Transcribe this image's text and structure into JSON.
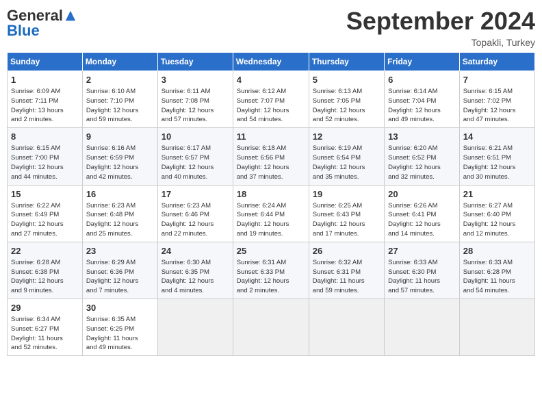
{
  "header": {
    "logo_general": "General",
    "logo_blue": "Blue",
    "month_title": "September 2024",
    "location": "Topakli, Turkey"
  },
  "days_of_week": [
    "Sunday",
    "Monday",
    "Tuesday",
    "Wednesday",
    "Thursday",
    "Friday",
    "Saturday"
  ],
  "weeks": [
    [
      {
        "day": "1",
        "info": "Sunrise: 6:09 AM\nSunset: 7:11 PM\nDaylight: 13 hours\nand 2 minutes."
      },
      {
        "day": "2",
        "info": "Sunrise: 6:10 AM\nSunset: 7:10 PM\nDaylight: 12 hours\nand 59 minutes."
      },
      {
        "day": "3",
        "info": "Sunrise: 6:11 AM\nSunset: 7:08 PM\nDaylight: 12 hours\nand 57 minutes."
      },
      {
        "day": "4",
        "info": "Sunrise: 6:12 AM\nSunset: 7:07 PM\nDaylight: 12 hours\nand 54 minutes."
      },
      {
        "day": "5",
        "info": "Sunrise: 6:13 AM\nSunset: 7:05 PM\nDaylight: 12 hours\nand 52 minutes."
      },
      {
        "day": "6",
        "info": "Sunrise: 6:14 AM\nSunset: 7:04 PM\nDaylight: 12 hours\nand 49 minutes."
      },
      {
        "day": "7",
        "info": "Sunrise: 6:15 AM\nSunset: 7:02 PM\nDaylight: 12 hours\nand 47 minutes."
      }
    ],
    [
      {
        "day": "8",
        "info": "Sunrise: 6:15 AM\nSunset: 7:00 PM\nDaylight: 12 hours\nand 44 minutes."
      },
      {
        "day": "9",
        "info": "Sunrise: 6:16 AM\nSunset: 6:59 PM\nDaylight: 12 hours\nand 42 minutes."
      },
      {
        "day": "10",
        "info": "Sunrise: 6:17 AM\nSunset: 6:57 PM\nDaylight: 12 hours\nand 40 minutes."
      },
      {
        "day": "11",
        "info": "Sunrise: 6:18 AM\nSunset: 6:56 PM\nDaylight: 12 hours\nand 37 minutes."
      },
      {
        "day": "12",
        "info": "Sunrise: 6:19 AM\nSunset: 6:54 PM\nDaylight: 12 hours\nand 35 minutes."
      },
      {
        "day": "13",
        "info": "Sunrise: 6:20 AM\nSunset: 6:52 PM\nDaylight: 12 hours\nand 32 minutes."
      },
      {
        "day": "14",
        "info": "Sunrise: 6:21 AM\nSunset: 6:51 PM\nDaylight: 12 hours\nand 30 minutes."
      }
    ],
    [
      {
        "day": "15",
        "info": "Sunrise: 6:22 AM\nSunset: 6:49 PM\nDaylight: 12 hours\nand 27 minutes."
      },
      {
        "day": "16",
        "info": "Sunrise: 6:23 AM\nSunset: 6:48 PM\nDaylight: 12 hours\nand 25 minutes."
      },
      {
        "day": "17",
        "info": "Sunrise: 6:23 AM\nSunset: 6:46 PM\nDaylight: 12 hours\nand 22 minutes."
      },
      {
        "day": "18",
        "info": "Sunrise: 6:24 AM\nSunset: 6:44 PM\nDaylight: 12 hours\nand 19 minutes."
      },
      {
        "day": "19",
        "info": "Sunrise: 6:25 AM\nSunset: 6:43 PM\nDaylight: 12 hours\nand 17 minutes."
      },
      {
        "day": "20",
        "info": "Sunrise: 6:26 AM\nSunset: 6:41 PM\nDaylight: 12 hours\nand 14 minutes."
      },
      {
        "day": "21",
        "info": "Sunrise: 6:27 AM\nSunset: 6:40 PM\nDaylight: 12 hours\nand 12 minutes."
      }
    ],
    [
      {
        "day": "22",
        "info": "Sunrise: 6:28 AM\nSunset: 6:38 PM\nDaylight: 12 hours\nand 9 minutes."
      },
      {
        "day": "23",
        "info": "Sunrise: 6:29 AM\nSunset: 6:36 PM\nDaylight: 12 hours\nand 7 minutes."
      },
      {
        "day": "24",
        "info": "Sunrise: 6:30 AM\nSunset: 6:35 PM\nDaylight: 12 hours\nand 4 minutes."
      },
      {
        "day": "25",
        "info": "Sunrise: 6:31 AM\nSunset: 6:33 PM\nDaylight: 12 hours\nand 2 minutes."
      },
      {
        "day": "26",
        "info": "Sunrise: 6:32 AM\nSunset: 6:31 PM\nDaylight: 11 hours\nand 59 minutes."
      },
      {
        "day": "27",
        "info": "Sunrise: 6:33 AM\nSunset: 6:30 PM\nDaylight: 11 hours\nand 57 minutes."
      },
      {
        "day": "28",
        "info": "Sunrise: 6:33 AM\nSunset: 6:28 PM\nDaylight: 11 hours\nand 54 minutes."
      }
    ],
    [
      {
        "day": "29",
        "info": "Sunrise: 6:34 AM\nSunset: 6:27 PM\nDaylight: 11 hours\nand 52 minutes."
      },
      {
        "day": "30",
        "info": "Sunrise: 6:35 AM\nSunset: 6:25 PM\nDaylight: 11 hours\nand 49 minutes."
      },
      {
        "day": "",
        "info": ""
      },
      {
        "day": "",
        "info": ""
      },
      {
        "day": "",
        "info": ""
      },
      {
        "day": "",
        "info": ""
      },
      {
        "day": "",
        "info": ""
      }
    ]
  ]
}
